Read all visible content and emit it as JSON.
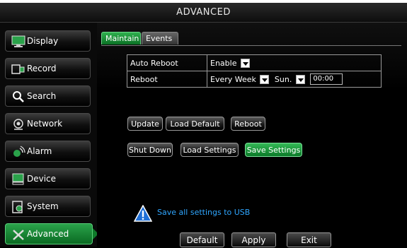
{
  "window": {
    "title": "ADVANCED"
  },
  "sidebar": {
    "items": [
      {
        "label": "Display",
        "icon": "monitor-icon"
      },
      {
        "label": "Record",
        "icon": "camera-icon"
      },
      {
        "label": "Search",
        "icon": "search-icon"
      },
      {
        "label": "Network",
        "icon": "network-icon"
      },
      {
        "label": "Alarm",
        "icon": "alarm-icon"
      },
      {
        "label": "Device",
        "icon": "device-icon"
      },
      {
        "label": "System",
        "icon": "system-icon"
      },
      {
        "label": "Advanced",
        "icon": "tools-icon",
        "active": true
      }
    ]
  },
  "tabs": [
    {
      "label": "Maintain",
      "active": true
    },
    {
      "label": "Events",
      "active": false
    }
  ],
  "settings": {
    "auto_reboot": {
      "label": "Auto Reboot",
      "value": "Enable"
    },
    "reboot": {
      "label": "Reboot",
      "frequency": "Every Week",
      "day": "Sun.",
      "time": "00:00"
    }
  },
  "buttons": {
    "update": "Update",
    "load_default": "Load Default",
    "reboot": "Reboot",
    "shut_down": "Shut Down",
    "load_settings": "Load Settings",
    "save_settings": "Save Settings"
  },
  "hint": {
    "icon": "warning-icon",
    "text": "Save all settings to USB"
  },
  "footer": {
    "default": "Default",
    "apply": "Apply",
    "exit": "Exit"
  },
  "colors": {
    "accent_green": "#1f9a3e",
    "hint_blue": "#2fa6ff"
  }
}
